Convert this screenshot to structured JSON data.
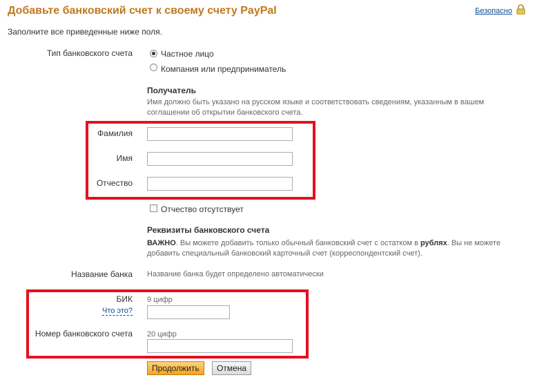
{
  "header": {
    "title": "Добавьте банковский счет к своему счету PayPal",
    "secure_label": "Безопасно"
  },
  "intro": "Заполните все приведенные ниже поля.",
  "account_type": {
    "label": "Тип банковского счета",
    "options": [
      "Частное лицо",
      "Компания или предприниматель"
    ],
    "selected": "Частное лицо"
  },
  "recipient": {
    "heading": "Получатель",
    "note": "Имя должно быть указано на русском языке и соответствовать сведениям, указанным в вашем соглашении об открытии банковского счета.",
    "last_name_label": "Фамилия",
    "last_name_value": "",
    "first_name_label": "Имя",
    "first_name_value": "",
    "middle_name_label": "Отчество",
    "middle_name_value": "",
    "no_middle_name_label": "Отчество отсутствует",
    "no_middle_name_checked": false
  },
  "bank_details": {
    "heading": "Реквизиты банковского счета",
    "note_bold": "ВАЖНО",
    "note_part1": ". Вы можете добавить только обычный банковский счет с остатком в ",
    "note_bold2": "рублях",
    "note_part2": ". Вы не можете добавить специальный банковский карточный счет (корреспондентский счет).",
    "bank_name_label": "Название банка",
    "bank_name_value": "Название банка будет определено автоматически",
    "bik_label": "БИК",
    "bik_whatis": "Что это?",
    "bik_hint": "9 цифр",
    "bik_value": "",
    "account_number_label": "Номер банковского счета",
    "account_number_hint": "20 цифр",
    "account_number_value": ""
  },
  "actions": {
    "continue_label": "Продолжить",
    "cancel_label": "Отмена"
  },
  "colors": {
    "title": "#c0781e",
    "link": "#114c96",
    "highlight_box": "#e4101f",
    "primary_button": "#f6a21c"
  }
}
